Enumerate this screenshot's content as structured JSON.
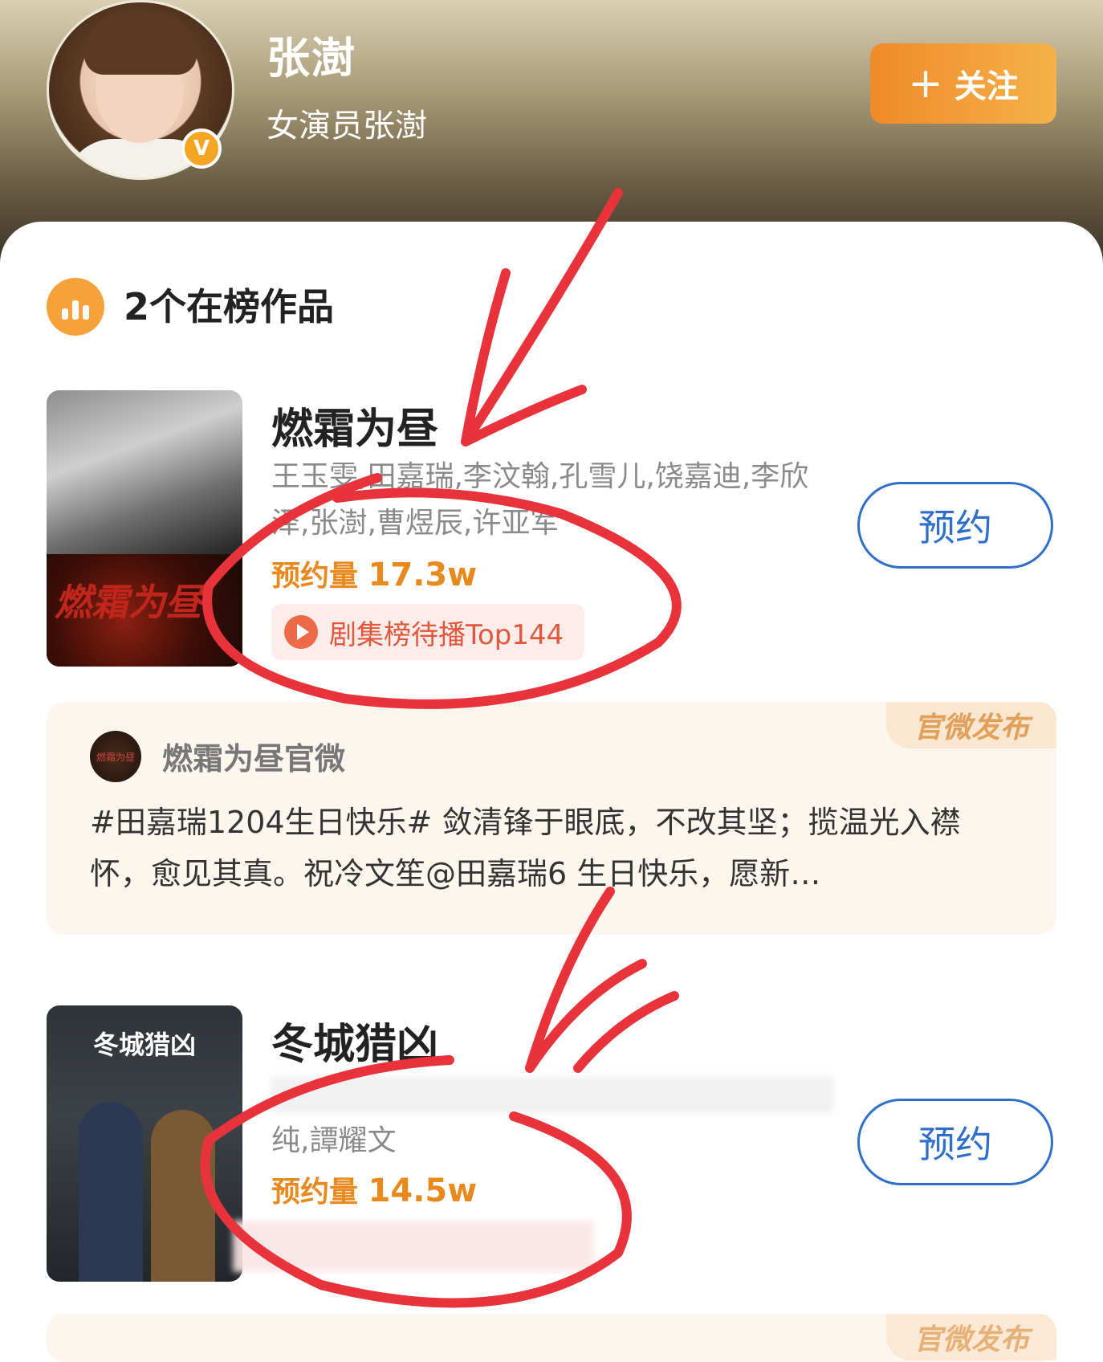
{
  "profile": {
    "name": "张澍",
    "subtitle": "女演员张澍",
    "verify_badge": "V",
    "follow_label": "关注",
    "follow_plus": "+"
  },
  "section": {
    "title": "2个在榜作品"
  },
  "works": [
    {
      "title": "燃霜为昼",
      "poster_title": "燃霜为昼",
      "cast": "王玉雯,田嘉瑞,李汶翰,孔雪儿,饶嘉迪,李欣泽,张澍,曹煜辰,许亚军",
      "reserve_label": "预约量",
      "reserve_count": "17.3w",
      "rank_tag": "剧集榜待播Top144",
      "button_label": "预约"
    },
    {
      "title": "冬城猎凶",
      "poster_title": "冬城猎凶",
      "cast_visible": "纯,譚耀文",
      "reserve_label": "预约量",
      "reserve_count": "14.5w",
      "button_label": "预约"
    }
  ],
  "official_post": {
    "tag": "官微发布",
    "account_name": "燃霜为昼官微",
    "avatar_text": "燃霜为昼",
    "text": "#田嘉瑞1204生日快乐# 敛清锋于眼底，不改其坚；揽温光入襟怀，愈见其真。祝冷文笙@田嘉瑞6 生日快乐，愿新…"
  },
  "official_post_2": {
    "tag": "官微发布"
  },
  "colors": {
    "accent_orange": "#f08a2a",
    "reserve_blue": "#2f6fc9",
    "annotation_red": "#e8333a"
  }
}
